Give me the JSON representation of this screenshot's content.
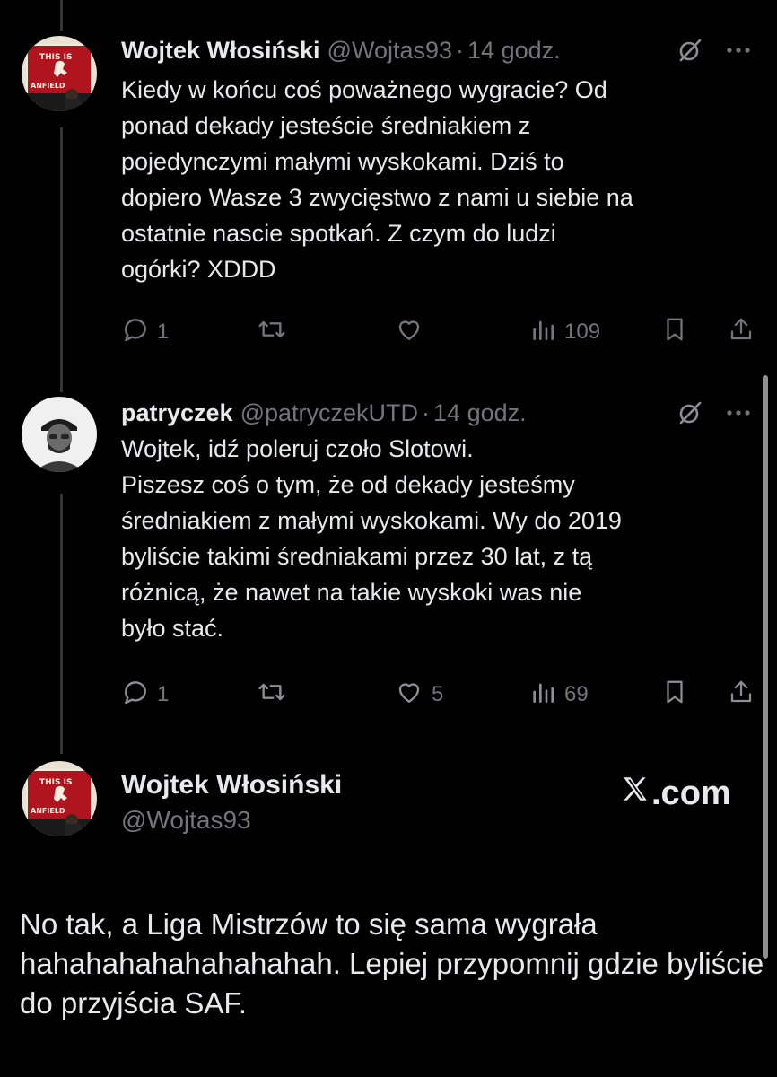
{
  "tweets": [
    {
      "name": "Wojtek Włosiński",
      "handle": "@Wojtas93",
      "time": "14 godz.",
      "text": "Kiedy w końcu coś poważnego wygracie? Od\nponad dekady jesteście średniakiem z\npojedynczymi małymi wyskokami. Dziś to\ndopiero Wasze 3 zwycięstwo z nami u siebie na\nostatnie nascie spotkań. Z czym do ludzi\nogórki? XDDD",
      "replies": "1",
      "retweets": "",
      "likes": "",
      "views": "109",
      "avatar_text_top": "THIS IS",
      "avatar_text_bottom": "ANFIELD"
    },
    {
      "name": "patryczek",
      "handle": "@patryczekUTD",
      "time": "14 godz.",
      "text": "Wojtek, idź poleruj czoło Slotowi.\nPiszesz coś o tym, że od dekady jesteśmy\nśredniakiem z małymi wyskokami. Wy do 2019\nbyliście takimi średniakami przez 30 lat, z tą\nróżnicą, że nawet na takie wyskoki was nie\nbyło stać.",
      "replies": "1",
      "retweets": "",
      "likes": "5",
      "views": "69"
    }
  ],
  "main_tweet": {
    "name": "Wojtek Włosiński",
    "handle": "@Wojtas93",
    "brand": ".com",
    "text": "No tak, a Liga Mistrzów to się sama wygrała hahahahahahahahahah. Lepiej przypomnij gdzie byliście do przyjścia SAF.",
    "avatar_text_top": "THIS IS",
    "avatar_text_bottom": "ANFIELD"
  },
  "colors": {
    "background": "#000000",
    "text": "#e7e9ea",
    "secondary": "#71767b",
    "thread_line": "#333639"
  },
  "icons": [
    "grok-icon",
    "more-icon",
    "reply-icon",
    "retweet-icon",
    "like-icon",
    "views-icon",
    "bookmark-icon",
    "share-icon",
    "x-logo-icon"
  ]
}
